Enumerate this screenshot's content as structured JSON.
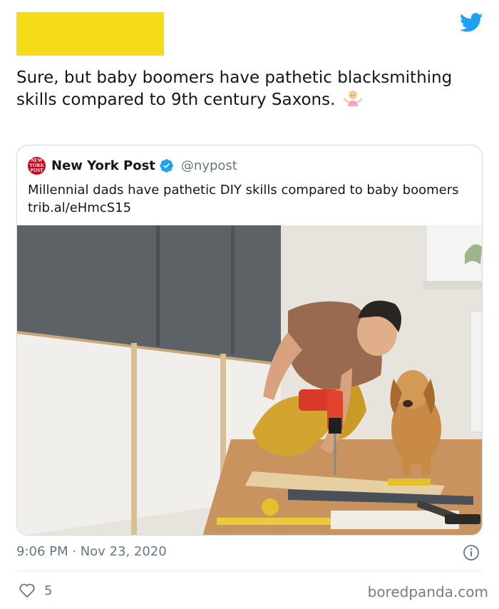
{
  "tweet": {
    "text": "Sure, but baby boomers have pathetic blacksmithing skills compared to 9th century Saxons.",
    "timestamp": "9:06 PM · Nov 23, 2020",
    "likes": "5"
  },
  "quoted_tweet": {
    "display_name": "New York Post",
    "handle": "@nypost",
    "avatar_text": "NEW YORK POST",
    "text": "Millennial dads have pathetic DIY skills compared to baby boomers trib.al/eHmcS15"
  },
  "icons": {
    "brand": "twitter-bird-icon",
    "verified": "verified-badge-icon",
    "emoji": "woman-shrugging-emoji",
    "info": "info-icon",
    "like": "heart-icon"
  },
  "colors": {
    "redaction": "#f5dc19",
    "twitter_blue": "#1da1f2",
    "nypost_red": "#d0021b"
  },
  "watermark": "boredpanda.com"
}
